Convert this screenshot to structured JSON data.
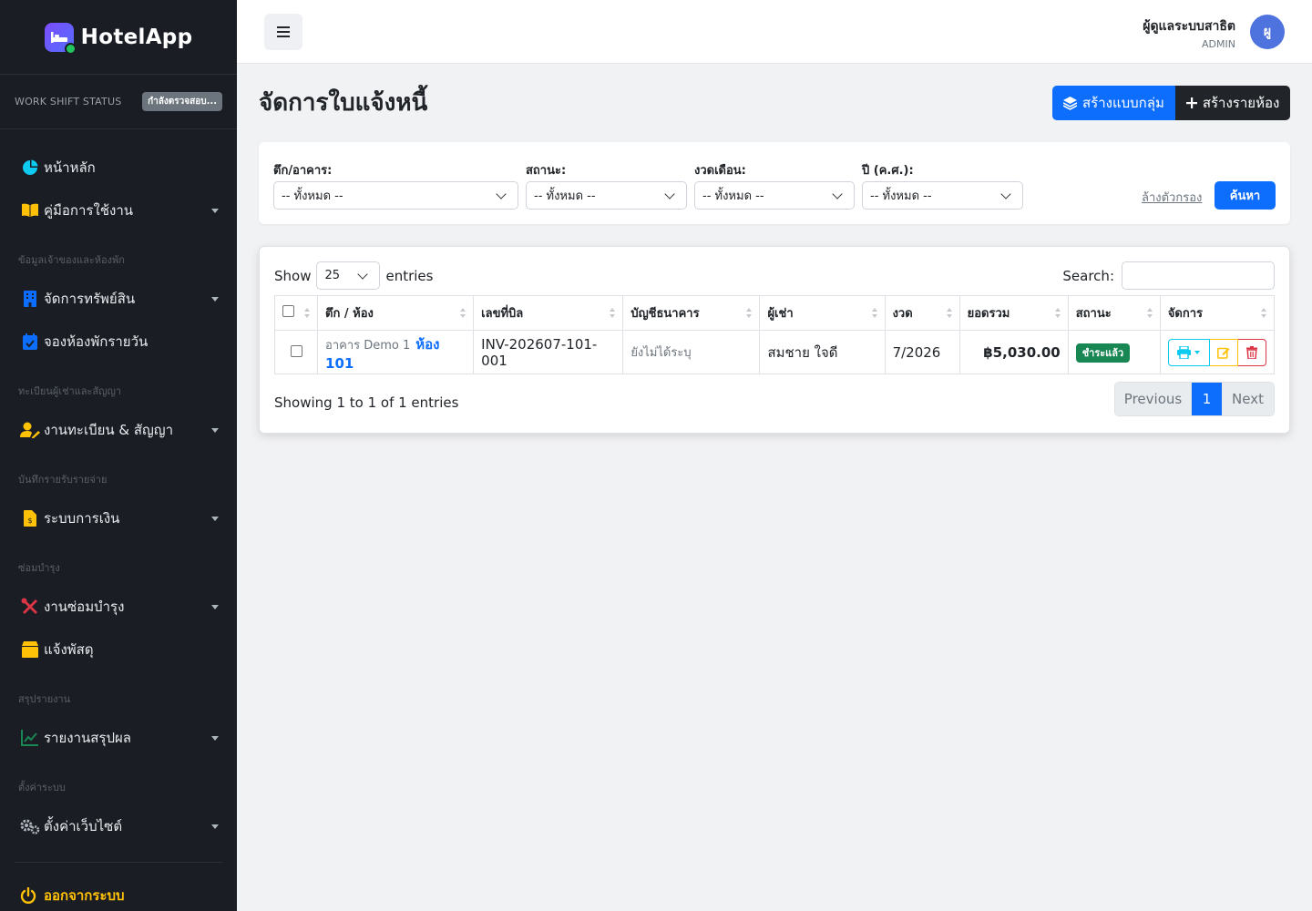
{
  "brand": {
    "name": "HotelApp",
    "logo_icon": "bed-check-icon"
  },
  "shift": {
    "label": "WORK SHIFT STATUS",
    "status": "กำลังตรวจสอบ..."
  },
  "sidebar": {
    "items": [
      {
        "label": "หน้าหลัก",
        "icon": "pie-chart-icon",
        "color": "#0dcaf0"
      },
      {
        "label": "คู่มือการใช้งาน",
        "icon": "book-icon",
        "color": "#ffc107"
      },
      {
        "section": "ข้อมูลเจ้าของและห้องพัก"
      },
      {
        "label": "จัดการทรัพย์สิน",
        "icon": "building-icon",
        "color": "#0d6efd"
      },
      {
        "label": "จองห้องพักรายวัน",
        "icon": "calendar-icon",
        "color": "#0d6efd"
      },
      {
        "section": "ทะเบียนผู้เช่าและสัญญา"
      },
      {
        "label": "งานทะเบียน & สัญญา",
        "icon": "user-edit-icon",
        "color": "#ffc107"
      },
      {
        "section": "บันทึกรายรับรายจ่าย"
      },
      {
        "label": "ระบบการเงิน",
        "icon": "invoice-icon",
        "color": "#ffc107"
      },
      {
        "section": "ซ่อมบำรุง"
      },
      {
        "label": "งานซ่อมบำรุง",
        "icon": "tools-icon",
        "color": "#dc3545"
      },
      {
        "label": "แจ้งพัสดุ",
        "icon": "box-icon",
        "color": "#ffc107"
      },
      {
        "section": "สรุปรายงาน"
      },
      {
        "label": "รายงานสรุปผล",
        "icon": "line-chart-icon",
        "color": "#198754"
      },
      {
        "section": "ตั้งค่าระบบ"
      },
      {
        "label": "ตั้งค่าเว็บไซต์",
        "icon": "gears-icon",
        "color": "#adb5bd"
      }
    ],
    "logout": "ออกจากระบบ"
  },
  "topbar": {
    "user_name": "ผู้ดูแลระบบสาธิต",
    "user_role": "ADMIN",
    "avatar_initials": "ผู"
  },
  "page": {
    "title": "จัดการใบแจ้งหนี้",
    "btn_bulk": "สร้างแบบกลุ่ม",
    "btn_single": "สร้างรายห้อง"
  },
  "filters": {
    "building_label": "ตึก/อาคาร:",
    "status_label": "สถานะ:",
    "month_label": "งวดเดือน:",
    "year_label": "ปี (ค.ศ.):",
    "building_value": "-- ทั้งหมด --",
    "status_value": "-- ทั้งหมด --",
    "month_value": "-- ทั้งหมด --",
    "year_value": "-- ทั้งหมด --",
    "clear": "ล้างตัวกรอง",
    "search": "ค้นหา"
  },
  "table": {
    "show_label": "Show",
    "entries_label": "entries",
    "length_value": "25",
    "search_label": "Search:",
    "columns": [
      "ตึก / ห้อง",
      "เลขที่บิล",
      "บัญชีธนาคาร",
      "ผู้เช่า",
      "งวด",
      "ยอดรวม",
      "สถานะ",
      "จัดการ"
    ],
    "rows": [
      {
        "building": "อาคาร Demo 1",
        "room": "ห้อง 101",
        "bill_no": "INV-202607-101-001",
        "bank": "ยังไม่ได้ระบุ",
        "tenant": "สมชาย ใจดี",
        "period": "7/2026",
        "total": "฿5,030.00",
        "status": "ชำระแล้ว"
      }
    ],
    "info": "Showing 1 to 1 of 1 entries",
    "prev": "Previous",
    "page": "1",
    "next": "Next"
  }
}
